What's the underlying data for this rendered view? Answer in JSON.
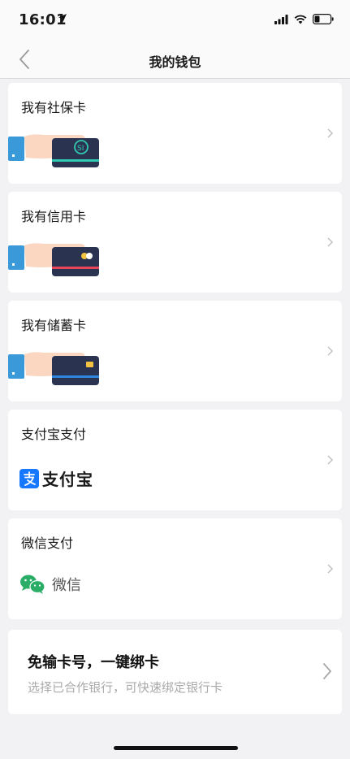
{
  "status": {
    "time": "16:01"
  },
  "nav": {
    "title": "我的钱包"
  },
  "cards": [
    {
      "title": "我有社保卡"
    },
    {
      "title": "我有信用卡"
    },
    {
      "title": "我有储蓄卡"
    },
    {
      "title": "支付宝支付",
      "logo_text": "支付宝"
    },
    {
      "title": "微信支付",
      "logo_text": "微信"
    }
  ],
  "promo": {
    "title": "免输卡号，一键绑卡",
    "subtitle": "选择已合作银行，可快速绑定银行卡"
  },
  "icons": {
    "location": "location-arrow-icon",
    "signal": "signal-icon",
    "wifi": "wifi-icon",
    "battery": "battery-icon",
    "back": "back-chevron-icon",
    "chevron": "chevron-right-icon"
  },
  "colors": {
    "alipay": "#1677ff",
    "wechat": "#2aae67",
    "social_card_accent": "#30c9b0",
    "credit_card_accent": "#e8445a",
    "debit_card_accent": "#2e86de"
  }
}
